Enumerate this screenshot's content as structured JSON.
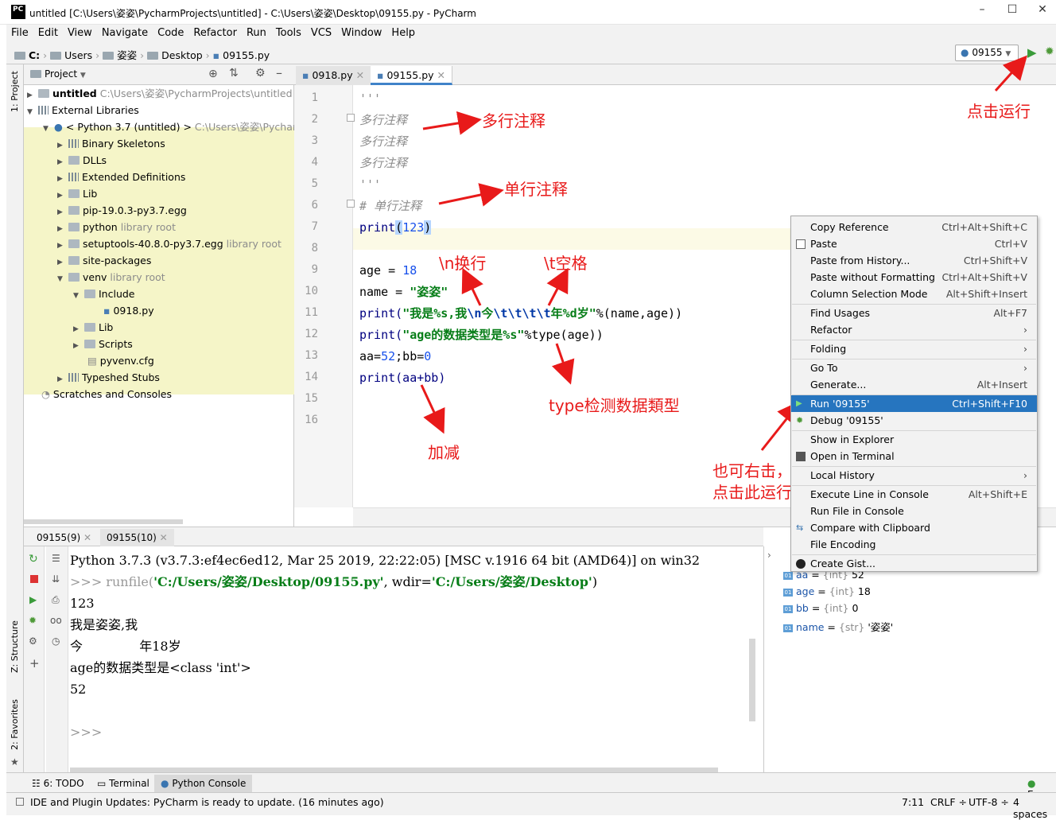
{
  "window": {
    "title": "untitled [C:\\Users\\姿姿\\PycharmProjects\\untitled] - C:\\Users\\姿姿\\Desktop\\09155.py - PyCharm",
    "logo": "PC",
    "minimize": "–",
    "maximize": "☐",
    "close": "✕"
  },
  "menu": [
    "File",
    "Edit",
    "View",
    "Navigate",
    "Code",
    "Refactor",
    "Run",
    "Tools",
    "VCS",
    "Window",
    "Help"
  ],
  "breadcrumb": [
    "C:",
    "Users",
    "姿姿",
    "Desktop",
    "09155.py"
  ],
  "run_config": {
    "label": "09155",
    "run_icon": "run-icon",
    "debug_icon": "debug-icon"
  },
  "left_strip": {
    "project": "1: Project",
    "structure": "Z: Structure",
    "favorites": "2: Favorites"
  },
  "project_panel": {
    "header": "Project",
    "tree": [
      {
        "label": "untitled",
        "hint": "C:\\Users\\姿姿\\PycharmProjects\\untitled",
        "bold": true
      },
      {
        "label": "External Libraries",
        "hint": ""
      },
      {
        "label": "< Python 3.7 (untitled) >",
        "hint": "C:\\Users\\姿姿\\Pycharm"
      },
      {
        "label": "Binary Skeletons",
        "hint": ""
      },
      {
        "label": "DLLs",
        "hint": ""
      },
      {
        "label": "Extended Definitions",
        "hint": ""
      },
      {
        "label": "Lib",
        "hint": ""
      },
      {
        "label": "pip-19.0.3-py3.7.egg",
        "hint": ""
      },
      {
        "label": "python",
        "hint": "library root"
      },
      {
        "label": "setuptools-40.8.0-py3.7.egg",
        "hint": "library root"
      },
      {
        "label": "site-packages",
        "hint": ""
      },
      {
        "label": "venv",
        "hint": "library root"
      },
      {
        "label": "Include",
        "hint": ""
      },
      {
        "label": "0918.py",
        "hint": ""
      },
      {
        "label": "Lib",
        "hint": ""
      },
      {
        "label": "Scripts",
        "hint": ""
      },
      {
        "label": "pyvenv.cfg",
        "hint": ""
      },
      {
        "label": "Typeshed Stubs",
        "hint": ""
      },
      {
        "label": "Scratches and Consoles",
        "hint": ""
      }
    ]
  },
  "editor_tabs": [
    "0918.py",
    "09155.py"
  ],
  "code_lines": [
    {
      "n": "1",
      "text": "'''"
    },
    {
      "n": "2",
      "text": "多行注释"
    },
    {
      "n": "3",
      "text": "多行注释"
    },
    {
      "n": "4",
      "text": "多行注释"
    },
    {
      "n": "5",
      "text": "'''"
    },
    {
      "n": "6",
      "text": "# 单行注释"
    },
    {
      "n": "7",
      "a": "print",
      "b": "(",
      "c": "123",
      "d": ")"
    },
    {
      "n": "8",
      "text": ""
    },
    {
      "n": "9",
      "a": "age = ",
      "b": "18"
    },
    {
      "n": "10",
      "a": "name = ",
      "b": "\"姿姿\""
    },
    {
      "n": "11",
      "a": "print(",
      "b": "\"我是%s,我",
      "c": "\\n",
      "d": "今",
      "e": "\\t\\t\\t\\t",
      "f": "年%d岁\"",
      "g": "%(name,age))"
    },
    {
      "n": "12",
      "a": "print(",
      "b": "\"age的数据类型是%s\"",
      "c": "%type(age))"
    },
    {
      "n": "13",
      "a": "aa=",
      "b": "52",
      "c": ";bb=",
      "d": "0"
    },
    {
      "n": "14",
      "a": "print(aa+bb)"
    },
    {
      "n": "15",
      "text": ""
    },
    {
      "n": "16",
      "text": ""
    }
  ],
  "annotations": {
    "multiline": "多行注释",
    "singleline": "单行注释",
    "newline": "\\n换行",
    "tab": "\\t空格",
    "add": "加减",
    "type": "type检测数据類型",
    "run_click": "点击运行",
    "right_click_1": "也可右击，",
    "right_click_2": "点击此运行"
  },
  "console_tabs": [
    "09155(9)",
    "09155(10)"
  ],
  "console_lines": {
    "l1": "Python 3.7.3 (v3.7.3:ef4ec6ed12, Mar 25 2019, 22:22:05) [MSC v.1916 64 bit (AMD64)] on win32",
    "l2a": ">>> runfile(",
    "l2b": "'C:/Users/姿姿/Desktop/09155.py'",
    "l2c": ", wdir=",
    "l2d": "'C:/Users/姿姿/Desktop'",
    "l2e": ")",
    "l3": "123",
    "l4": "我是姿姿,我",
    "l5": "今              年18岁",
    "l6": "age的数据类型是<class 'int'>",
    "l7": "52",
    "l8": ">>>"
  },
  "variables": [
    {
      "name": "aa",
      "type": "{int}",
      "value": "52"
    },
    {
      "name": "age",
      "type": "{int}",
      "value": "18"
    },
    {
      "name": "bb",
      "type": "{int}",
      "value": "0"
    },
    {
      "name": "name",
      "type": "{str}",
      "value": "'姿姿'"
    }
  ],
  "context_menu": [
    {
      "label": "Copy Reference",
      "shortcut": "Ctrl+Alt+Shift+C"
    },
    {
      "label": "Paste",
      "shortcut": "Ctrl+V"
    },
    {
      "label": "Paste from History...",
      "shortcut": "Ctrl+Shift+V"
    },
    {
      "label": "Paste without Formatting",
      "shortcut": "Ctrl+Alt+Shift+V"
    },
    {
      "label": "Column Selection Mode",
      "shortcut": "Alt+Shift+Insert"
    },
    {
      "label": "Find Usages",
      "shortcut": "Alt+F7"
    },
    {
      "label": "Refactor",
      "shortcut": "›"
    },
    {
      "label": "Folding",
      "shortcut": "›"
    },
    {
      "label": "Go To",
      "shortcut": "›"
    },
    {
      "label": "Generate...",
      "shortcut": "Alt+Insert"
    },
    {
      "label": "Run '09155'",
      "shortcut": "Ctrl+Shift+F10"
    },
    {
      "label": "Debug '09155'",
      "shortcut": ""
    },
    {
      "label": "Show in Explorer",
      "shortcut": ""
    },
    {
      "label": "Open in Terminal",
      "shortcut": ""
    },
    {
      "label": "Local History",
      "shortcut": "›"
    },
    {
      "label": "Execute Line in Console",
      "shortcut": "Alt+Shift+E"
    },
    {
      "label": "Run File in Console",
      "shortcut": ""
    },
    {
      "label": "Compare with Clipboard",
      "shortcut": ""
    },
    {
      "label": "File Encoding",
      "shortcut": ""
    },
    {
      "label": "Create Gist...",
      "shortcut": ""
    }
  ],
  "bottom_tools": [
    "6: TODO",
    "Terminal",
    "Python Console"
  ],
  "event_log": "Ever",
  "status": {
    "message": "IDE and Plugin Updates: PyCharm is ready to update. (16 minutes ago)",
    "position": "7:11",
    "line_sep": "CRLF ÷",
    "encoding": "UTF-8 ÷",
    "indent": "4 spaces"
  },
  "colors": {
    "accent": "#2675bf",
    "annotation": "#e81a1a",
    "string": "#067d17",
    "number": "#1750eb"
  }
}
